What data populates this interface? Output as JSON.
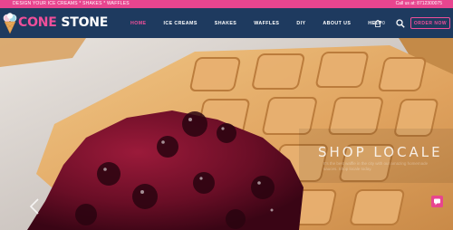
{
  "topbar": {
    "tagline": "DESIGN YOUR ICE CREAMS * SHAKES * WAFFLES",
    "phone": "Call us at: 8712300075"
  },
  "logo": {
    "word1": "CONE",
    "word2": " STONE"
  },
  "menu": {
    "items": [
      "HOME",
      "ICE CREAMS",
      "SHAKES",
      "WAFFLES",
      "DIY",
      "ABOUT US",
      "HELP"
    ]
  },
  "cart": {
    "count": "0"
  },
  "order_button": "ORDER NOW",
  "hero": {
    "title": "SHOP LOCALE",
    "subtitle": "It's the best waffle in the city with our amazing homemade sauces. Shop locale today."
  },
  "colors": {
    "pink": "#e8458f",
    "navy": "#1e3a5f",
    "gold_border": "#f04f9a"
  }
}
